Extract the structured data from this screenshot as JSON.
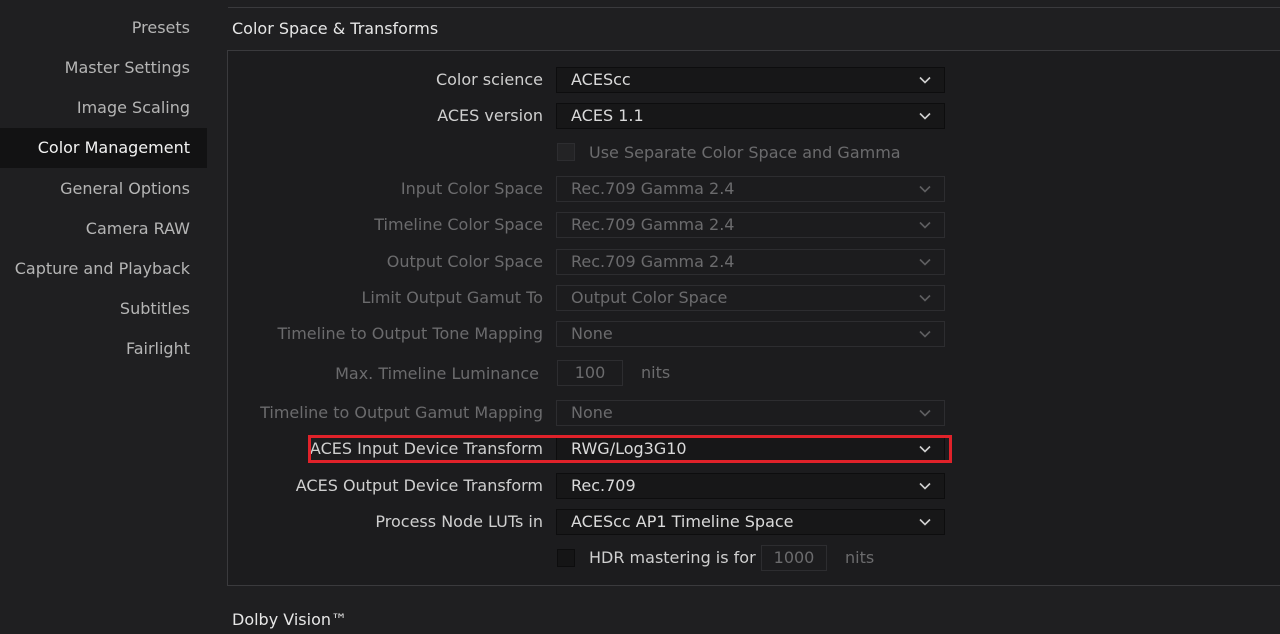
{
  "sidebar": {
    "items": [
      {
        "label": "Presets"
      },
      {
        "label": "Master Settings"
      },
      {
        "label": "Image Scaling"
      },
      {
        "label": "Color Management"
      },
      {
        "label": "General Options"
      },
      {
        "label": "Camera RAW"
      },
      {
        "label": "Capture and Playback"
      },
      {
        "label": "Subtitles"
      },
      {
        "label": "Fairlight"
      }
    ],
    "active": "Color Management"
  },
  "section": {
    "title": "Color Space & Transforms",
    "color_science": {
      "label": "Color science",
      "value": "ACEScc"
    },
    "aces_version": {
      "label": "ACES version",
      "value": "ACES 1.1"
    },
    "separate_gamma": {
      "label": "Use Separate Color Space and Gamma",
      "checked": false
    },
    "input_cs": {
      "label": "Input Color Space",
      "value": "Rec.709 Gamma 2.4"
    },
    "timeline_cs": {
      "label": "Timeline Color Space",
      "value": "Rec.709 Gamma 2.4"
    },
    "output_cs": {
      "label": "Output Color Space",
      "value": "Rec.709 Gamma 2.4"
    },
    "limit_gamut": {
      "label": "Limit Output Gamut To",
      "value": "Output Color Space"
    },
    "tone_mapping": {
      "label": "Timeline to Output Tone Mapping",
      "value": "None"
    },
    "max_luminance": {
      "label": "Max. Timeline Luminance",
      "value": "100",
      "unit": "nits"
    },
    "gamut_mapping": {
      "label": "Timeline to Output Gamut Mapping",
      "value": "None"
    },
    "aces_idt": {
      "label": "ACES Input Device Transform",
      "value": "RWG/Log3G10"
    },
    "aces_odt": {
      "label": "ACES Output Device Transform",
      "value": "Rec.709"
    },
    "process_luts": {
      "label": "Process Node LUTs in",
      "value": "ACEScc AP1 Timeline Space"
    },
    "hdr_mastering": {
      "label": "HDR mastering is for",
      "value": "1000",
      "unit": "nits",
      "checked": false
    }
  },
  "next_section": {
    "title": "Dolby Vision™"
  },
  "colors": {
    "highlight": "#e0222a",
    "active_nav_bg": "#121213"
  },
  "icons": {
    "dropdown": "chevron-down-icon"
  }
}
